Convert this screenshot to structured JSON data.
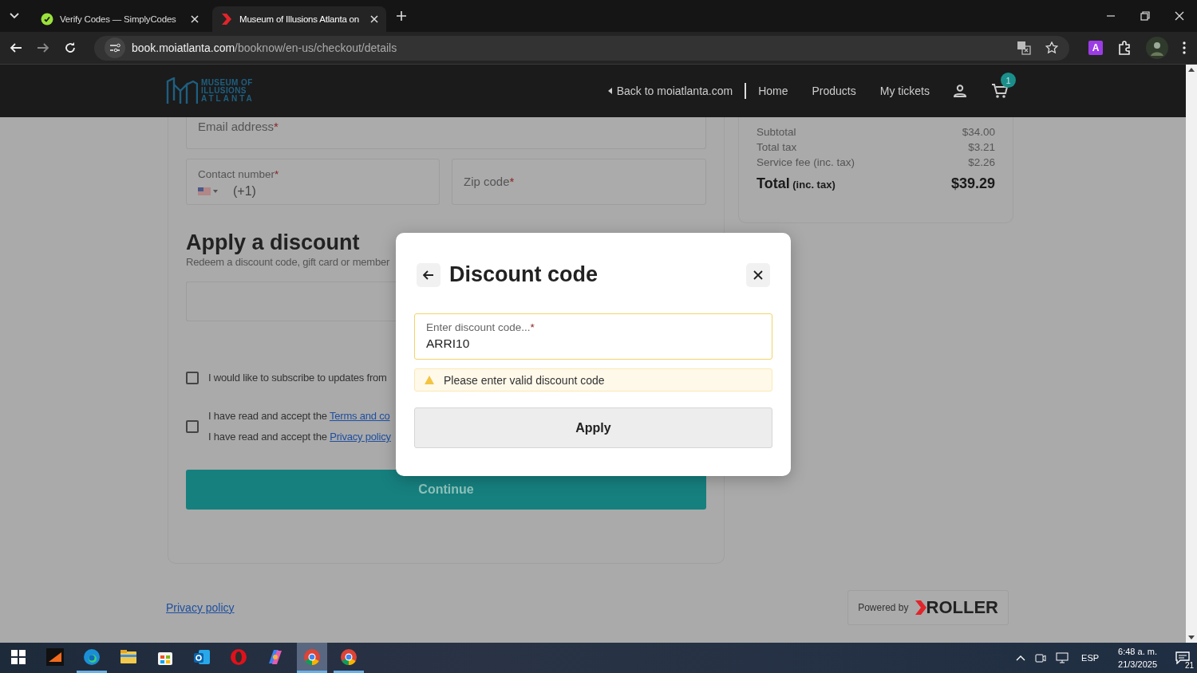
{
  "browser": {
    "tabs": [
      {
        "title": "Verify Codes — SimplyCodes",
        "selected": false
      },
      {
        "title": "Museum of Illusions Atlanta on",
        "selected": true
      }
    ],
    "address": {
      "domain": "book.moiatlanta.com",
      "path": "/booknow/en-us/checkout/details"
    },
    "profile_letter": "A"
  },
  "site_header": {
    "logo_lines": [
      "MUSEUM OF",
      "ILLUSIONS",
      "ATLANTA"
    ],
    "back_link": "Back to moiatlanta.com",
    "nav": [
      "Home",
      "Products",
      "My tickets"
    ],
    "cart_count": "1"
  },
  "form": {
    "email": {
      "label": "Email address",
      "required_mark": "*"
    },
    "contact": {
      "label": "Contact number",
      "required_mark": "*",
      "dial_code": "(+1)"
    },
    "zip": {
      "label": "Zip code",
      "required_mark": "*"
    },
    "discount": {
      "title": "Apply a discount",
      "subtitle": "Redeem a discount code, gift card or member"
    },
    "checkboxes": [
      {
        "checked": false,
        "lines": [
          {
            "text": "I would like to subscribe to updates from"
          }
        ]
      },
      {
        "checked": false,
        "lines": [
          {
            "text": "I have read and accept the",
            "link": "Terms and co"
          },
          {
            "text": "I have read and accept the",
            "link": "Privacy policy"
          }
        ]
      }
    ],
    "continue_button": "Continue"
  },
  "summary": {
    "rows": [
      {
        "label": "Subtotal",
        "value": "$34.00"
      },
      {
        "label": "Total tax",
        "value": "$3.21"
      },
      {
        "label": "Service fee (inc. tax)",
        "value": "$2.26"
      }
    ],
    "total": {
      "label": "Total",
      "note": "(inc. tax)",
      "value": "$39.29"
    }
  },
  "modal": {
    "title": "Discount code",
    "input": {
      "label": "Enter discount code...",
      "required_mark": "*",
      "value": "ARRI10"
    },
    "warning": "Please enter valid discount code",
    "apply_button": "Apply"
  },
  "footer": {
    "privacy_link": "Privacy policy",
    "powered_by": "Powered by",
    "brand": "ROLLER"
  },
  "taskbar": {
    "apps": [
      {
        "kind": "start",
        "open": false,
        "selected": false
      },
      {
        "kind": "app",
        "open": false,
        "selected": false
      },
      {
        "kind": "edge",
        "open": true,
        "selected": false
      },
      {
        "kind": "files",
        "open": false,
        "selected": false
      },
      {
        "kind": "store",
        "open": false,
        "selected": false
      },
      {
        "kind": "outlook",
        "open": false,
        "selected": false
      },
      {
        "kind": "opera",
        "open": false,
        "selected": false
      },
      {
        "kind": "copilot",
        "open": false,
        "selected": false
      },
      {
        "kind": "chrome",
        "open": true,
        "selected": true
      },
      {
        "kind": "chrome",
        "open": true,
        "selected": false
      }
    ],
    "language": "ESP",
    "time": "6:48 a. m.",
    "date": "21/3/2025",
    "notifications": "21"
  }
}
